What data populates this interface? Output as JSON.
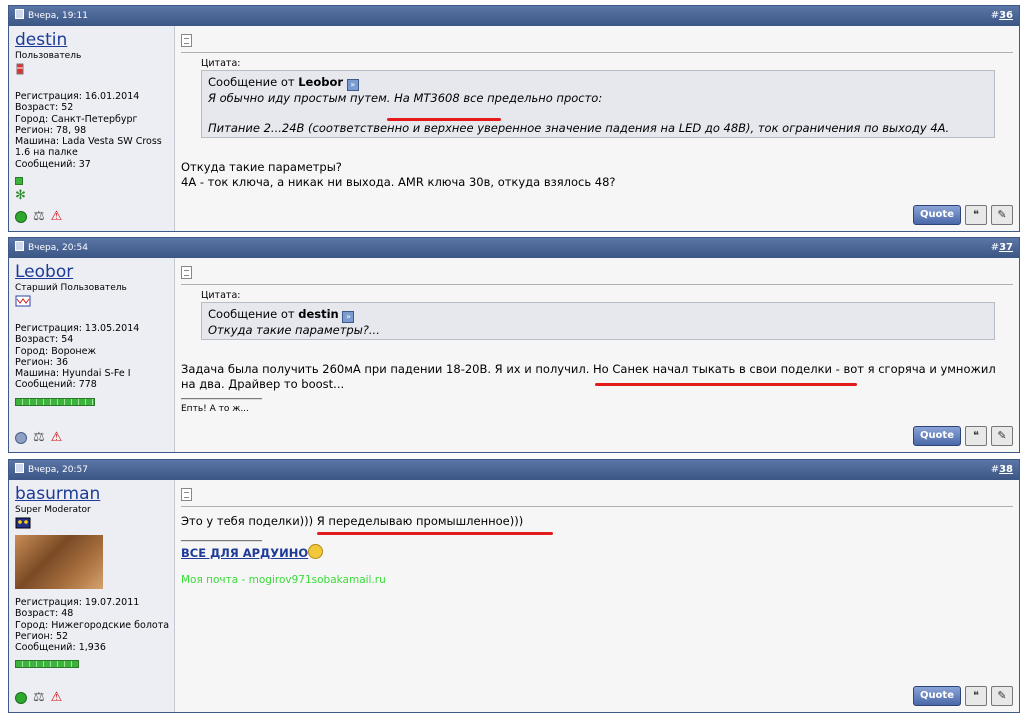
{
  "posts": [
    {
      "date": "Вчера, 19:11",
      "num_prefix": "#",
      "num": "36",
      "user": {
        "name": "destin",
        "title": "Пользователь",
        "info": [
          "Регистрация: 16.01.2014",
          "Возраст: 52",
          "Город: Санкт-Петербург",
          "Регион: 78, 98",
          "Машина: Lada Vesta SW Cross",
          "1.6 на палке",
          "Сообщений: 37"
        ]
      },
      "quote_label": "Цитата:",
      "quote_from": "Сообщение от",
      "quote_author": "Leobor",
      "quote_lines": [
        "Я обычно иду простым путем. На МТ3608 все предельно просто:",
        "",
        "Питание 2...24В (соответственно и верхнее уверенное значение падения на LED до 48В), ток ограничения по выходу 4А."
      ],
      "text_lines": [
        "Откуда такие параметры?",
        "4А - ток ключа, а никак ни выхода. AMR ключа 30в, откуда взялось 48?"
      ],
      "status": "online"
    },
    {
      "date": "Вчера, 20:54",
      "num_prefix": "#",
      "num": "37",
      "user": {
        "name": "Leobor",
        "title": "Старший Пользователь",
        "info": [
          "Регистрация: 13.05.2014",
          "Возраст: 54",
          "Город: Воронеж",
          "Регион: 36",
          "Машина: Hyundai S-Fe I",
          "Сообщений: 778"
        ]
      },
      "quote_label": "Цитата:",
      "quote_from": "Сообщение от",
      "quote_author": "destin",
      "quote_lines": [
        "Откуда такие параметры?..."
      ],
      "text_lines": [
        "Задача была получить 260мА при падении 18-20В. Я их и получил. Но Санек начал тыкать в свои поделки - вот я сгоряча и умножил",
        "на два. Драйвер то boost..."
      ],
      "signature_rule": "__________________",
      "signature": "Епть! А то ж...",
      "status": "offline"
    },
    {
      "date": "Вчера, 20:57",
      "num_prefix": "#",
      "num": "38",
      "user": {
        "name": "basurman",
        "title": "Super Moderator",
        "info": [
          "Регистрация: 19.07.2011",
          "Возраст: 48",
          "Город: Нижегородские болота",
          "Регион: 52",
          "Сообщений: 1,936"
        ]
      },
      "text_lines": [
        "Это у тебя поделки))) Я переделываю промышленное)))"
      ],
      "signature_rule": "__________________",
      "signature_link": "ВСЕ ДЛЯ АРДУИНО",
      "signature_mail": "Моя почта - mogirov971sobakamail.ru",
      "status": "online"
    }
  ],
  "buttons": {
    "quote": "Quote"
  },
  "icons": {
    "post_doc": "document-icon",
    "online": "online-status-icon",
    "offline": "offline-status-icon",
    "reputation": "scales-icon",
    "report": "warning-icon",
    "multiquote": "multiquote-icon",
    "edit": "edit-icon"
  },
  "colors": {
    "header_bg": "#3b5685",
    "username": "#1d3b97",
    "annotation_red": "#e31b1b",
    "signature_green": "#3adb3a"
  }
}
